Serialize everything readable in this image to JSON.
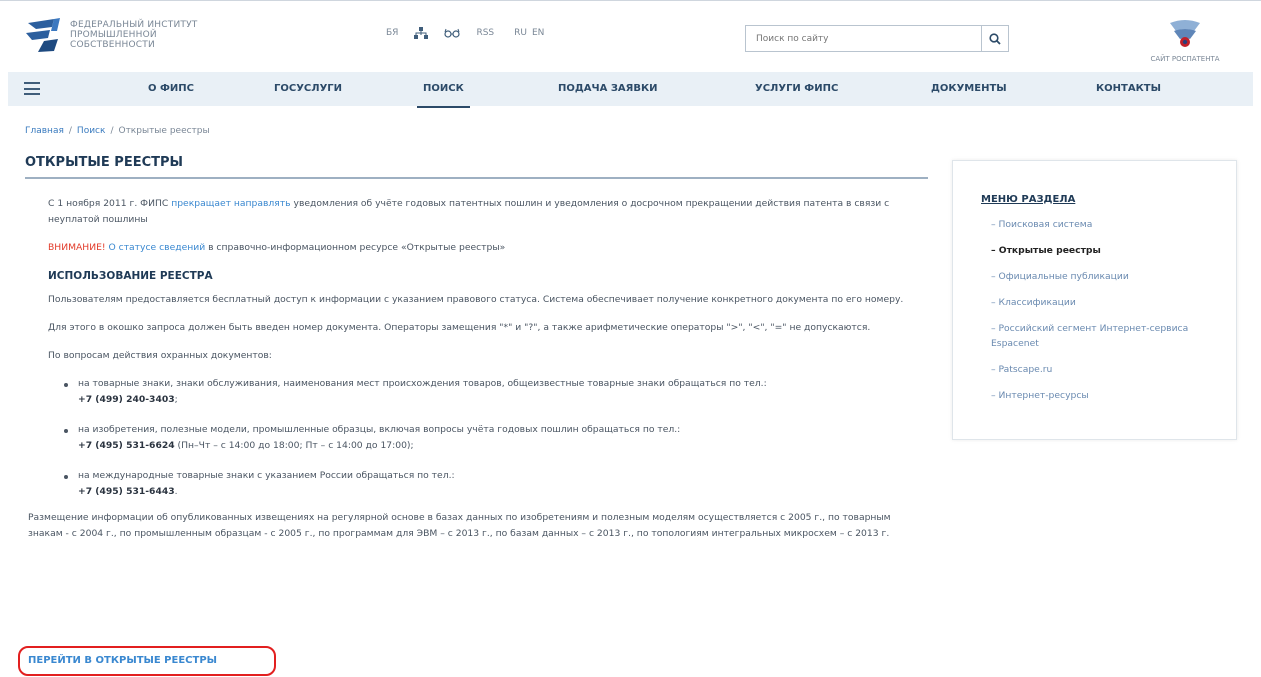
{
  "header": {
    "logo_lines": [
      "ФЕДЕРАЛЬНЫЙ ИНСТИТУТ",
      "ПРОМЫШЛЕННОЙ",
      "СОБСТВЕННОСТИ"
    ],
    "tools": {
      "sign_language": "БЯ",
      "rss": "RSS",
      "lang_ru": "RU",
      "lang_en": "EN"
    },
    "search_placeholder": "Поиск по сайту",
    "rospatent_label": "САЙТ РОСПАТЕНТА"
  },
  "nav": {
    "items": [
      "О ФИПС",
      "ГОСУСЛУГИ",
      "ПОИСК",
      "ПОДАЧА ЗАЯВКИ",
      "УСЛУГИ ФИПС",
      "ДОКУМЕНТЫ",
      "КОНТАКТЫ"
    ]
  },
  "breadcrumb": {
    "home": "Главная",
    "search": "Поиск",
    "current": "Открытые реестры",
    "sep": "/"
  },
  "page_title": "ОТКРЫТЫЕ РЕЕСТРЫ",
  "content": {
    "intro_a": "С 1 ноября 2011 г. ФИПС ",
    "intro_link": "прекращает направлять",
    "intro_b": " уведомления об учёте годовых патентных пошлин и уведомления о досрочном прекращении действия патента в связи с неуплатой пошлины",
    "warn_label": "ВНИМАНИЕ!",
    "warn_link": " О статусе сведений",
    "warn_rest": " в справочно-информационном ресурсе «Открытые реестры»",
    "usage_title": "ИСПОЛЬЗОВАНИЕ РЕЕСТРА",
    "usage_p1": "Пользователям предоставляется бесплатный доступ к информации с указанием правового статуса. Система обеспечивает получение конкретного документа по его номеру.",
    "usage_p2": "Для этого в окошко запроса должен быть введен номер документа. Операторы замещения \"*\" и \"?\", а также арифметические операторы \">\", \"<\", \"=\" не допускаются.",
    "usage_p3": "По вопросам действия охранных документов:",
    "contacts": [
      {
        "text": "на товарные знаки, знаки обслуживания, наименования мест происхождения товаров, общеизвестные товарные знаки обращаться по тел.:",
        "phone": "+7 (499) 240-3403",
        "extra": ";"
      },
      {
        "text": "на изобретения, полезные модели, промышленные образцы, включая вопросы учёта годовых пошлин обращаться по тел.:",
        "phone": "+7 (495) 531-6624",
        "extra": " (Пн–Чт – с 14:00 до 18:00; Пт – с 14:00 до 17:00);"
      },
      {
        "text": "на международные товарные знаки с указанием России обращаться по тел.:",
        "phone": "+7 (495) 531-6443",
        "extra": "."
      }
    ],
    "closing": "Размещение информации об опубликованных извещениях на регулярной основе в базах данных по изобретениям и полезным моделям осуществляется с 2005 г., по товарным знакам - с 2004 г., по промышленным образцам - с 2005 г., по программам для ЭВМ – с 2013 г., по базам данных – с 2013 г., по топологиям интегральных микросхем – с 2013 г.",
    "cta_label": "ПЕРЕЙТИ В ОТКРЫТЫЕ РЕЕСТРЫ"
  },
  "side_menu": {
    "title": "МЕНЮ РАЗДЕЛА",
    "items": [
      "– Поисковая система",
      "– Открытые реестры",
      "– Официальные публикации",
      "– Классификации",
      "– Российский сегмент Интернет-сервиса Espacenet",
      "– Patscape.ru",
      "– Интернет-ресурсы"
    ],
    "active_index": 1
  },
  "colors": {
    "nav_bg": "#e9f0f6",
    "title": "#1f3a56",
    "link": "#3a88d0",
    "warning": "#e23b2a",
    "highlight_outline": "#e21f1f"
  }
}
